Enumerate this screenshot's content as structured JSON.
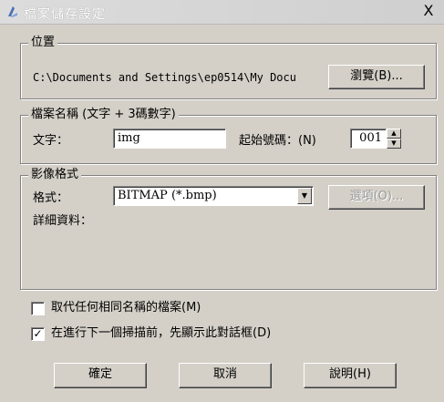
{
  "window": {
    "title": "檔案儲存設定",
    "close": "X"
  },
  "location": {
    "group_label": "位置",
    "path": "C:\\Documents and Settings\\ep0514\\My Docu",
    "browse_button": "瀏覽(B)..."
  },
  "filename": {
    "group_label": "檔案名稱 (文字 + 3碼數字)",
    "text_label": "文字：",
    "text_value": "img",
    "start_label": "起始號碼：(N)",
    "start_value": "001"
  },
  "image_format": {
    "group_label": "影像格式",
    "format_label": "格式：",
    "format_value": "BITMAP (*.bmp)",
    "options_button": "選項(O)...",
    "details_label": "詳細資料："
  },
  "checkboxes": [
    {
      "label": "取代任何相同名稱的檔案(M)",
      "checked": false,
      "mark": ""
    },
    {
      "label": "在進行下一個掃描前，先顯示此對話框(D)",
      "checked": true,
      "mark": "✓"
    }
  ],
  "buttons": {
    "ok": "確定",
    "cancel": "取消",
    "help": "說明(H)"
  }
}
